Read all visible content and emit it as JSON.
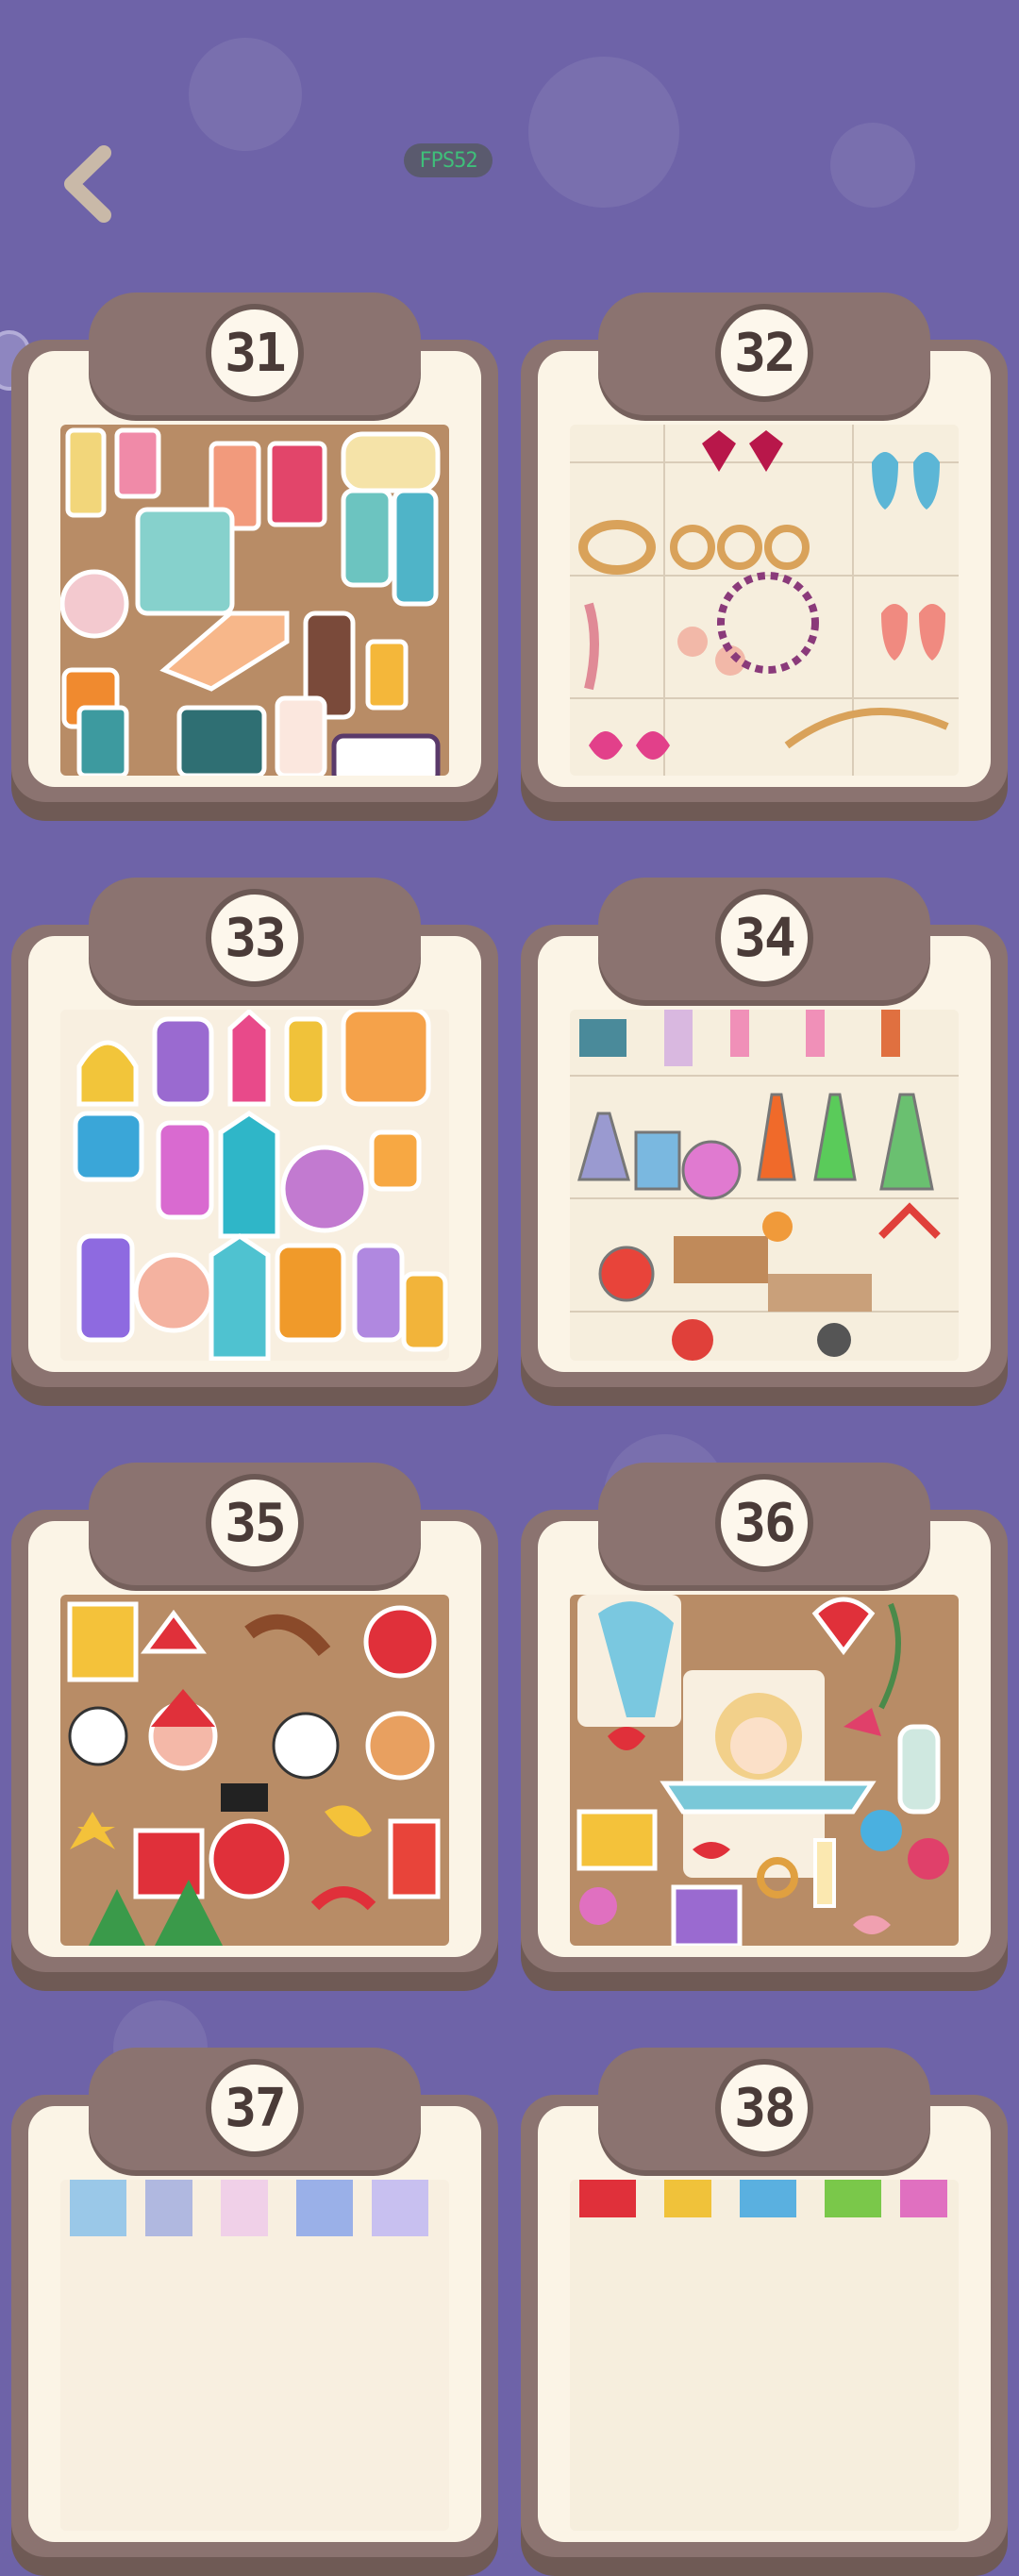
{
  "fps": "FPS52",
  "icons": {
    "back": "chevron-left-icon"
  },
  "colors": {
    "background": "#6e63a8",
    "frame": "#8b7370",
    "card": "#fbf4e6",
    "fps_text": "#3fbf7a"
  },
  "levels": [
    {
      "number": "31",
      "theme": "cosmetics"
    },
    {
      "number": "32",
      "theme": "jewelry"
    },
    {
      "number": "33",
      "theme": "perfume"
    },
    {
      "number": "34",
      "theme": "laboratory"
    },
    {
      "number": "35",
      "theme": "christmas"
    },
    {
      "number": "36",
      "theme": "valentine"
    },
    {
      "number": "37",
      "theme": "clothing"
    },
    {
      "number": "38",
      "theme": "party"
    }
  ]
}
